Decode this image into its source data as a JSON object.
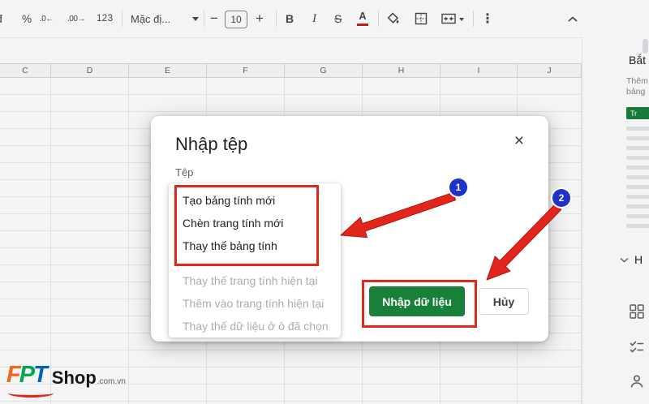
{
  "toolbar": {
    "currency": "đ",
    "percent": "%",
    "decrease_decimal": ".0←",
    "increase_decimal": ".00→",
    "more_formats": "123",
    "font_name": "Mặc đị...",
    "decrease_font": "−",
    "font_size": "10",
    "increase_font": "+",
    "bold": "B",
    "italic": "I",
    "strikethrough": "S",
    "text_color": "A",
    "more": "⋮"
  },
  "sheet": {
    "columns": [
      "C",
      "D",
      "E",
      "F",
      "G",
      "H",
      "I",
      "J"
    ]
  },
  "dialog": {
    "title": "Nhập tệp",
    "close": "×",
    "file_label": "Tệp",
    "options_active": [
      "Tạo bảng tính mới",
      "Chèn trang tính mới",
      "Thay thế bảng tính"
    ],
    "options_disabled": [
      "Thay thế trang tính hiện tại",
      "Thêm vào trang tính hiện tại",
      "Thay thế dữ liệu ở ô đã chọn"
    ],
    "import_button": "Nhập dữ liệu",
    "cancel_button": "Hủy"
  },
  "annotations": {
    "step1": "1",
    "step2": "2"
  },
  "side_panel": {
    "title": "Bắt",
    "line1": "Thêm",
    "line2": "bảng",
    "template_tag": "Tr",
    "section_letter": "H"
  },
  "logo": {
    "f": "F",
    "p": "P",
    "t": "T",
    "shop": "Shop",
    "domain": ".com.vn"
  },
  "colors": {
    "accent_green": "#188038",
    "annotation_red": "#e2261c",
    "badge_blue": "#1d33c8"
  }
}
